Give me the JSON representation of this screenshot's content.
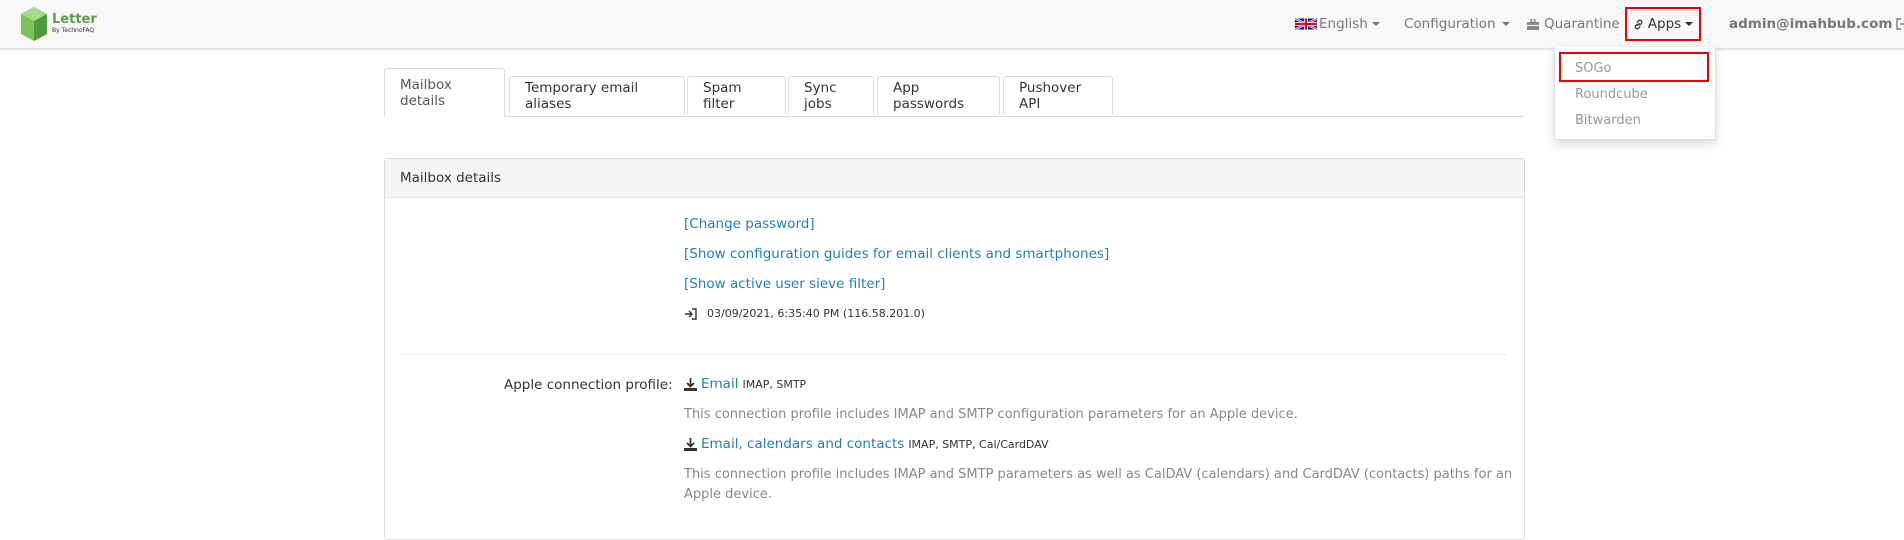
{
  "brand": {
    "title": "Letter",
    "subtitle": "By TechnoFAQ"
  },
  "nav": {
    "language": "English",
    "configuration": "Configuration",
    "quarantine": "Quarantine",
    "apps": "Apps",
    "user": "admin@imahbub.com"
  },
  "apps_menu": [
    "SOGo",
    "Roundcube",
    "Bitwarden"
  ],
  "tabs": [
    "Mailbox details",
    "Temporary email aliases",
    "Spam filter",
    "Sync jobs",
    "App passwords",
    "Pushover API"
  ],
  "panel": {
    "title": "Mailbox details",
    "change_password": "[Change password]",
    "config_guides": "[Show configuration guides for email clients and smartphones]",
    "sieve_filter": "[Show active user sieve filter]",
    "last_login": "03/09/2021, 6:35:40 PM (116.58.201.0)",
    "apple_label": "Apple connection profile:",
    "email_link": "Email",
    "email_protocols": "IMAP, SMTP",
    "email_desc": "This connection profile includes IMAP and SMTP configuration parameters for an Apple device.",
    "full_link": "Email, calendars and contacts",
    "full_protocols": "IMAP, SMTP, Cal/CardDAV",
    "full_desc": "This connection profile includes IMAP and SMTP parameters as well as CalDAV (calendars) and CardDAV (contacts) paths for an Apple device."
  },
  "colors": {
    "accent": "#1f7ec0",
    "highlight": "#ee0000",
    "brand": "#5b9a4a"
  }
}
